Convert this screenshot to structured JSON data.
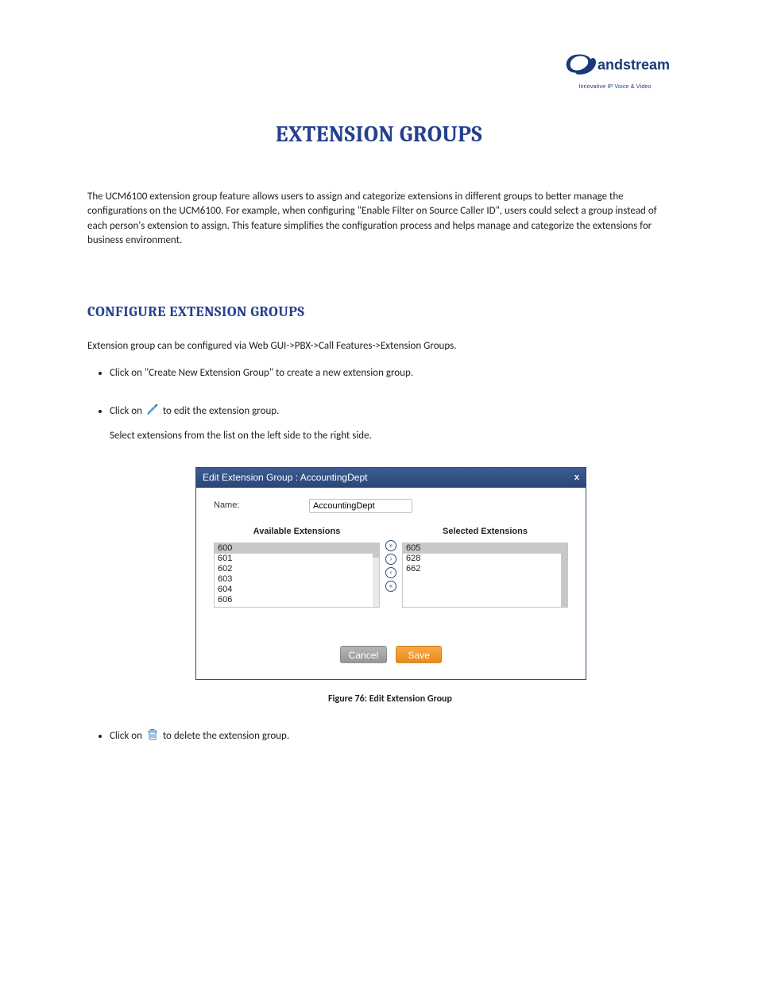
{
  "logo": {
    "brand_text": "andstream",
    "tagline": "Innovative IP Voice & Video"
  },
  "main_title": "EXTENSION GROUPS",
  "intro_paragraph": "The UCM6100 extension group feature allows users to assign and categorize extensions in different groups to better manage the configurations on the UCM6100. For example, when configuring \"Enable Filter on Source Caller ID\", users could select a group instead of each person's extension to assign. This feature simplifies the configuration process and helps manage and categorize the extensions for business environment.",
  "section_title": "CONFIGURE EXTENSION GROUPS",
  "config_intro": "Extension group can be configured via Web GUI->PBX->Call Features->Extension Groups.",
  "bullets": {
    "create": "Click on \"Create New Extension Group\" to create a new extension group.",
    "edit_prefix": "Click on ",
    "edit_suffix": "to edit the extension group.",
    "edit_detail": "Select extensions from the list on the left side to the right side.",
    "delete_prefix": "Click on ",
    "delete_suffix": "to delete the extension group."
  },
  "dialog": {
    "title": "Edit Extension Group : AccountingDept",
    "close": "x",
    "name_label": "Name:",
    "name_value": "AccountingDept",
    "available_header": "Available Extensions",
    "selected_header": "Selected Extensions",
    "available": [
      "600",
      "601",
      "602",
      "603",
      "604",
      "606"
    ],
    "selected": [
      "605",
      "628",
      "662"
    ],
    "arrows": {
      "all_right": "»",
      "one_right": "›",
      "one_left": "‹",
      "all_left": "«"
    },
    "cancel": "Cancel",
    "save": "Save"
  },
  "figure_caption": "Figure 76: Edit Extension Group"
}
